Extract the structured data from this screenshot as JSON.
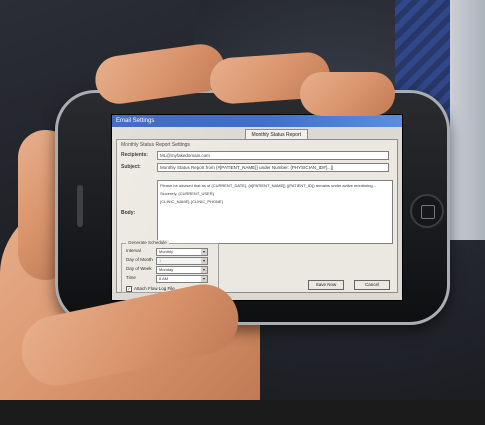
{
  "window": {
    "title": "Email Settings",
    "tab_label": "Monthly Status Report",
    "section_label": "Monthly Status Report Settings"
  },
  "fields": {
    "recipients_label": "Recipients:",
    "recipients_value": "ML@myfakedomain.com",
    "subject_label": "Subject:",
    "subject_value": "Monthly Status Report from {#[PATIENT_NAME]} under Number: {PHYSICIAN_ID#[...]}",
    "body_label": "Body:",
    "body_paragraphs": [
      "Please be advised that as of {CURRENT_DATE}, {#[PATIENT_NAME]} ({PATIENT_ID}) remains under active monitoring...",
      "Sincerely, {CURRENT_USER}",
      "{CLINIC_NAME} {CLINIC_PHONE}"
    ]
  },
  "schedule": {
    "title": "Generate Schedule",
    "rows": [
      {
        "label": "Interval",
        "value": "Monthly",
        "disabled": false
      },
      {
        "label": "Day of Month",
        "value": "1",
        "disabled": true
      },
      {
        "label": "Day of Week",
        "value": "Monday",
        "disabled": false
      },
      {
        "label": "Time",
        "value": "8 AM",
        "disabled": false
      }
    ],
    "checkbox_label": "Attach Flow Log File",
    "checkbox_checked": true
  },
  "buttons": {
    "save": "Save Now",
    "cancel": "Cancel"
  }
}
